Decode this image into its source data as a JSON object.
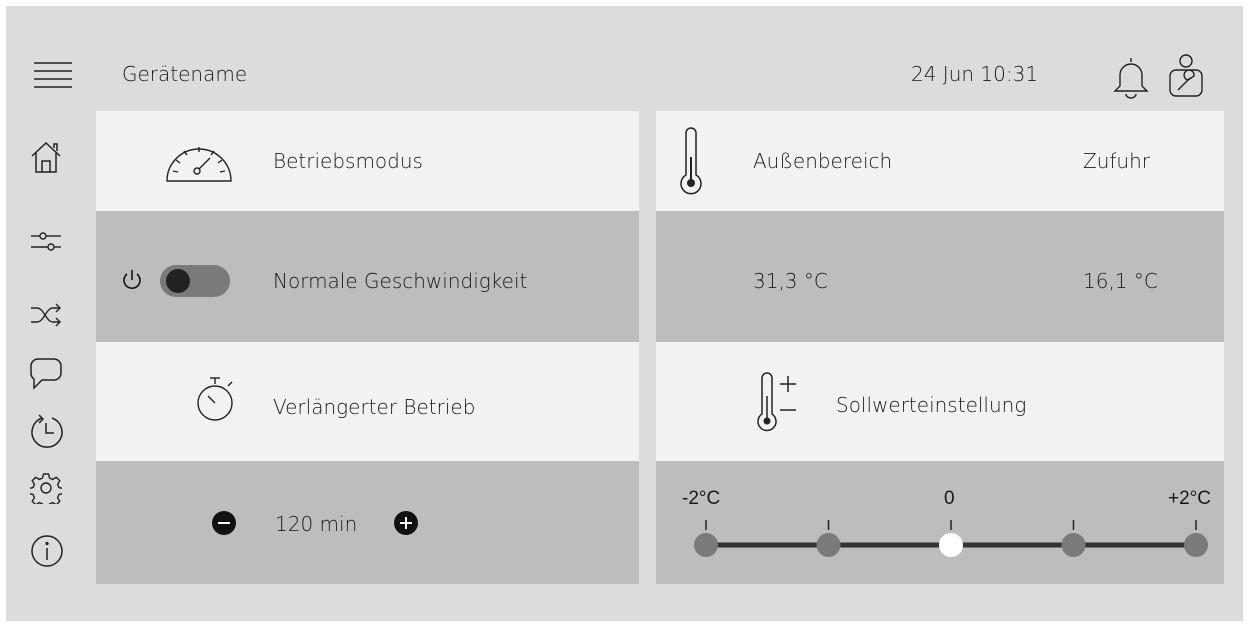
{
  "header": {
    "device_name": "Gerätename",
    "datetime": "24 Jun 10:31"
  },
  "sidebar": {
    "items": [
      {
        "icon": "home-icon"
      },
      {
        "icon": "sliders-icon"
      },
      {
        "icon": "shuffle-icon"
      },
      {
        "icon": "chat-icon"
      },
      {
        "icon": "history-icon"
      },
      {
        "icon": "gear-icon"
      },
      {
        "icon": "info-icon"
      }
    ]
  },
  "operation": {
    "title": "Betriebsmodus",
    "mode_label": "Normale Geschwindigkeit",
    "power_on": false
  },
  "extended": {
    "title": "Verlängerter Betrieb",
    "duration": "120 min"
  },
  "temperatures": {
    "outdoor_label": "Außenbereich",
    "supply_label": "Zufuhr",
    "outdoor_value": "31,3 °C",
    "supply_value": "16,1 °C"
  },
  "setpoint": {
    "title": "Sollwerteinstellung",
    "ticks": [
      "-2°C",
      "0",
      "+2°C"
    ],
    "selected_index": 2,
    "positions": 5
  },
  "colors": {
    "background": "#dcdcdc",
    "panel_light": "#f2f2f2",
    "panel_dark": "#bdbdbd",
    "slider_knob": "#7a7a7a",
    "slider_selected": "#ffffff"
  }
}
